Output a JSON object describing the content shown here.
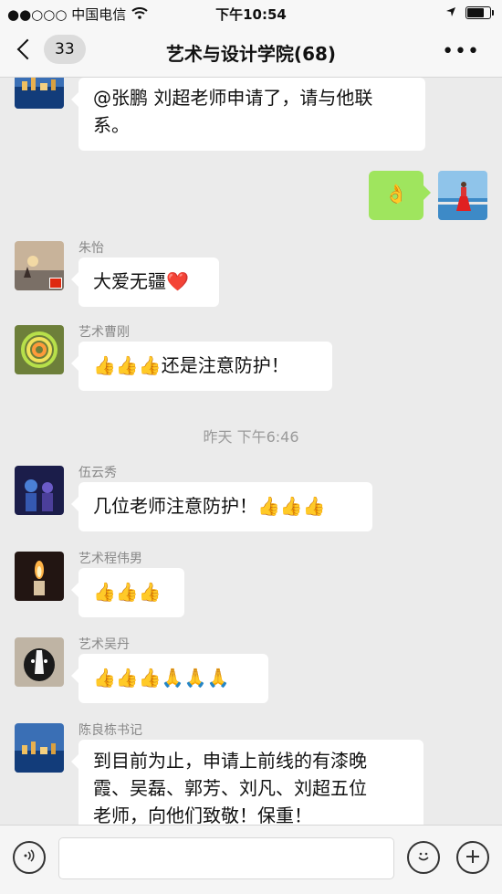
{
  "status_bar": {
    "carrier": "●●○○○ 中国电信",
    "time": "下午10:54",
    "battery_level": 0.8
  },
  "nav": {
    "back_count": "33",
    "title": "艺术与设计学院(68)",
    "more": "•••"
  },
  "messages": [
    {
      "sender": "",
      "text": "@张鹏 刘超老师申请了，请与他联系。",
      "lines": [
        "@张鹏 刘超老师申请了，请与他联",
        "系。"
      ],
      "avatar": "city-night-avatar"
    },
    {
      "sender": "",
      "text": "👌",
      "self": true,
      "avatar": "woman-red-dress-avatar"
    },
    {
      "sender": "朱怡",
      "text": "大爱无疆❤️",
      "avatar": "sunset-avatar"
    },
    {
      "sender": "艺术曹刚",
      "text": "👍👍👍还是注意防护！",
      "avatar": "rainbow-slinky-avatar"
    },
    {
      "sender": "伍云秀",
      "text": "几位老师注意防护！👍👍👍",
      "avatar": "night-figures-avatar"
    },
    {
      "sender": "艺术程伟男",
      "text": "👍👍👍",
      "avatar": "candle-avatar"
    },
    {
      "sender": "艺术吴丹",
      "text": "👍👍👍🙏🙏🙏",
      "avatar": "dog-avatar"
    },
    {
      "sender": "陈良栋书记",
      "text": "到目前为止，申请上前线的有漆晚霞、吴磊、郭芳、刘凡、刘超五位老师，向他们致敬！保重！",
      "lines": [
        "到目前为止，申请上前线的有漆晚",
        "霞、吴磊、郭芳、刘凡、刘超五位",
        "老师，向他们致敬！保重！"
      ],
      "avatar": "city-night-avatar"
    }
  ],
  "timestamp": "昨天 下午6:46",
  "input_bar": {
    "voice_icon": "voice-icon",
    "emoji_icon": "emoji-icon",
    "plus_icon": "plus-icon",
    "placeholder": ""
  }
}
